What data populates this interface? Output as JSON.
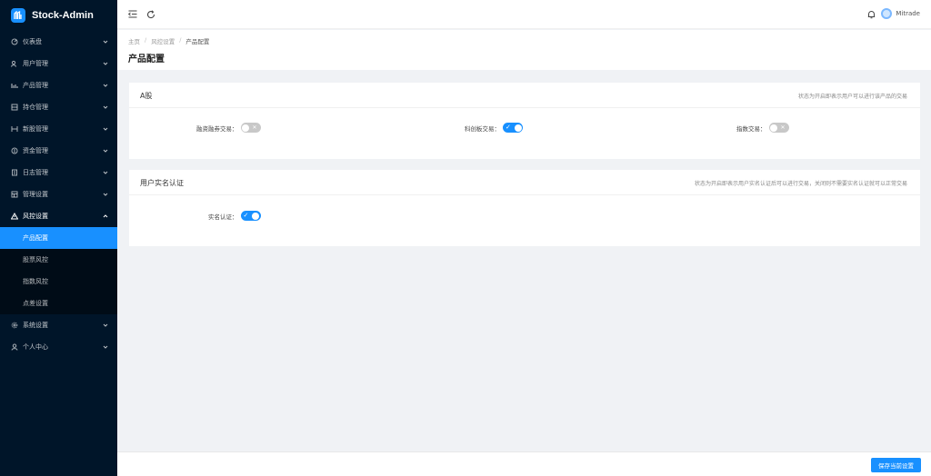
{
  "app": {
    "title": "Stock-Admin",
    "logo_icon": "stock-logo-icon"
  },
  "sidebar": {
    "items": [
      {
        "label": "仪表盘",
        "icon": "dashboard-icon"
      },
      {
        "label": "用户管理",
        "icon": "users-icon"
      },
      {
        "label": "产品管理",
        "icon": "chart-icon"
      },
      {
        "label": "持仓管理",
        "icon": "portfolio-icon"
      },
      {
        "label": "新股管理",
        "icon": "ipo-icon"
      },
      {
        "label": "资金管理",
        "icon": "money-icon"
      },
      {
        "label": "日志管理",
        "icon": "log-icon"
      },
      {
        "label": "管理设置",
        "icon": "admin-settings-icon"
      },
      {
        "label": "风控设置",
        "icon": "warning-icon",
        "open": true
      },
      {
        "label": "系统设置",
        "icon": "gear-icon"
      },
      {
        "label": "个人中心",
        "icon": "person-icon"
      }
    ],
    "submenu": [
      {
        "label": "产品配置",
        "active": true
      },
      {
        "label": "股票风控"
      },
      {
        "label": "指数风控"
      },
      {
        "label": "点差设置"
      }
    ]
  },
  "header": {
    "username": "Mitrade"
  },
  "breadcrumb": {
    "home": "主页",
    "parent": "风控设置",
    "current": "产品配置",
    "separator": "/"
  },
  "page": {
    "title": "产品配置"
  },
  "card_a": {
    "title": "A股",
    "note": "状态为开启即表示用户可以进行该产品的交易",
    "fields": [
      {
        "label": "融资融券交易：",
        "on": false
      },
      {
        "label": "科创板交易：",
        "on": true
      },
      {
        "label": "指数交易：",
        "on": false
      }
    ]
  },
  "card_b": {
    "title": "用户实名认证",
    "note": "状态为开启即表示用户实名认证后可以进行交易，关闭则不需要实名认证就可以正常交易",
    "fields": [
      {
        "label": "实名认证：",
        "on": true
      }
    ]
  },
  "footer": {
    "save_label": "保存当前设置"
  },
  "colors": {
    "primary": "#1890ff",
    "sidebar_bg": "#001529",
    "submenu_bg": "#000c17",
    "switch_off": "#c8c8c8"
  }
}
